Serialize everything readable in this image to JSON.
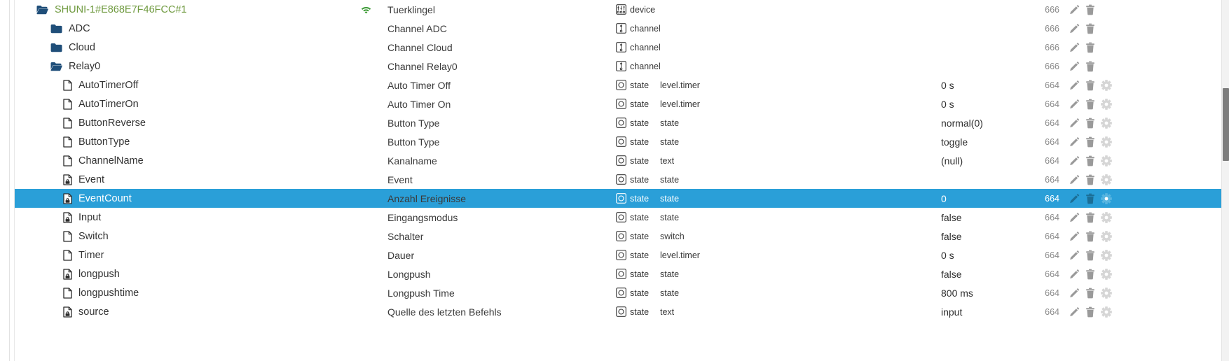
{
  "tree": {
    "selected_row_index": 10,
    "accent_selected": "#2a9fd8",
    "device_name_color": "#6f9a3f",
    "permission_folder": "666",
    "permission_state": "664",
    "icons": {
      "folder_open": "folder-open-icon",
      "folder_closed": "folder-closed-icon",
      "document": "document-icon",
      "document_locked": "document-locked-icon",
      "wifi": "wifi-icon",
      "edit_signature": "edit-signature-icon",
      "device_badge": "device-badge-icon",
      "channel_badge": "channel-badge-icon",
      "state_badge": "state-badge-icon",
      "pencil": "pencil-icon",
      "trash": "trash-icon",
      "gear": "gear-icon"
    },
    "rows": [
      {
        "name": "SHUNI-1#E868E7F46FCC#1",
        "level": 0,
        "icon": "folder-open-icon",
        "wifi": true,
        "desc": "Tuerklingel",
        "type": "device",
        "type_icon": "device-badge-icon",
        "role": "",
        "value": "",
        "perm": "666",
        "gear": false,
        "edit_mark": false
      },
      {
        "name": "ADC",
        "level": 1,
        "icon": "folder-closed-icon",
        "wifi": false,
        "desc": "Channel ADC",
        "type": "channel",
        "type_icon": "channel-badge-icon",
        "role": "",
        "value": "",
        "perm": "666",
        "gear": false,
        "edit_mark": false
      },
      {
        "name": "Cloud",
        "level": 1,
        "icon": "folder-closed-icon",
        "wifi": false,
        "desc": "Channel Cloud",
        "type": "channel",
        "type_icon": "channel-badge-icon",
        "role": "",
        "value": "",
        "perm": "666",
        "gear": false,
        "edit_mark": false
      },
      {
        "name": "Relay0",
        "level": 1,
        "icon": "folder-open-icon",
        "wifi": false,
        "desc": "Channel Relay0",
        "type": "channel",
        "type_icon": "channel-badge-icon",
        "role": "",
        "value": "",
        "perm": "666",
        "gear": false,
        "edit_mark": false
      },
      {
        "name": "AutoTimerOff",
        "level": 2,
        "icon": "document-icon",
        "wifi": false,
        "desc": "Auto Timer Off",
        "type": "state",
        "type_icon": "state-badge-icon",
        "role": "level.timer",
        "value": "0 s",
        "perm": "664",
        "gear": true,
        "edit_mark": false
      },
      {
        "name": "AutoTimerOn",
        "level": 2,
        "icon": "document-icon",
        "wifi": false,
        "desc": "Auto Timer On",
        "type": "state",
        "type_icon": "state-badge-icon",
        "role": "level.timer",
        "value": "0 s",
        "perm": "664",
        "gear": true,
        "edit_mark": false
      },
      {
        "name": "ButtonReverse",
        "level": 2,
        "icon": "document-icon",
        "wifi": false,
        "desc": "Button Type",
        "type": "state",
        "type_icon": "state-badge-icon",
        "role": "state",
        "value": "normal(0)",
        "perm": "664",
        "gear": true,
        "edit_mark": false
      },
      {
        "name": "ButtonType",
        "level": 2,
        "icon": "document-icon",
        "wifi": false,
        "desc": "Button Type",
        "type": "state",
        "type_icon": "state-badge-icon",
        "role": "state",
        "value": "toggle",
        "perm": "664",
        "gear": true,
        "edit_mark": false
      },
      {
        "name": "ChannelName",
        "level": 2,
        "icon": "document-icon",
        "wifi": false,
        "desc": "Kanalname",
        "type": "state",
        "type_icon": "state-badge-icon",
        "role": "text",
        "value": "(null)",
        "perm": "664",
        "gear": true,
        "edit_mark": true
      },
      {
        "name": "Event",
        "level": 2,
        "icon": "document-locked-icon",
        "wifi": false,
        "desc": "Event",
        "type": "state",
        "type_icon": "state-badge-icon",
        "role": "state",
        "value": "",
        "perm": "664",
        "gear": true,
        "edit_mark": false
      },
      {
        "name": "EventCount",
        "level": 2,
        "icon": "document-locked-icon",
        "wifi": false,
        "desc": "Anzahl Ereignisse",
        "type": "state",
        "type_icon": "state-badge-icon",
        "role": "state",
        "value": "0",
        "perm": "664",
        "gear": true,
        "edit_mark": false
      },
      {
        "name": "Input",
        "level": 2,
        "icon": "document-locked-icon",
        "wifi": false,
        "desc": "Eingangsmodus",
        "type": "state",
        "type_icon": "state-badge-icon",
        "role": "state",
        "value": "false",
        "perm": "664",
        "gear": true,
        "edit_mark": false
      },
      {
        "name": "Switch",
        "level": 2,
        "icon": "document-icon",
        "wifi": false,
        "desc": "Schalter",
        "type": "state",
        "type_icon": "state-badge-icon",
        "role": "switch",
        "value": "false",
        "perm": "664",
        "gear": true,
        "edit_mark": false
      },
      {
        "name": "Timer",
        "level": 2,
        "icon": "document-icon",
        "wifi": false,
        "desc": "Dauer",
        "type": "state",
        "type_icon": "state-badge-icon",
        "role": "level.timer",
        "value": "0 s",
        "perm": "664",
        "gear": true,
        "edit_mark": false
      },
      {
        "name": "longpush",
        "level": 2,
        "icon": "document-locked-icon",
        "wifi": false,
        "desc": "Longpush",
        "type": "state",
        "type_icon": "state-badge-icon",
        "role": "state",
        "value": "false",
        "perm": "664",
        "gear": true,
        "edit_mark": false
      },
      {
        "name": "longpushtime",
        "level": 2,
        "icon": "document-icon",
        "wifi": false,
        "desc": "Longpush Time",
        "type": "state",
        "type_icon": "state-badge-icon",
        "role": "state",
        "value": "800 ms",
        "perm": "664",
        "gear": true,
        "edit_mark": false
      },
      {
        "name": "source",
        "level": 2,
        "icon": "document-locked-icon",
        "wifi": false,
        "desc": "Quelle des letzten Befehls",
        "type": "state",
        "type_icon": "state-badge-icon",
        "role": "text",
        "value": "input",
        "perm": "664",
        "gear": true,
        "edit_mark": false
      }
    ]
  }
}
